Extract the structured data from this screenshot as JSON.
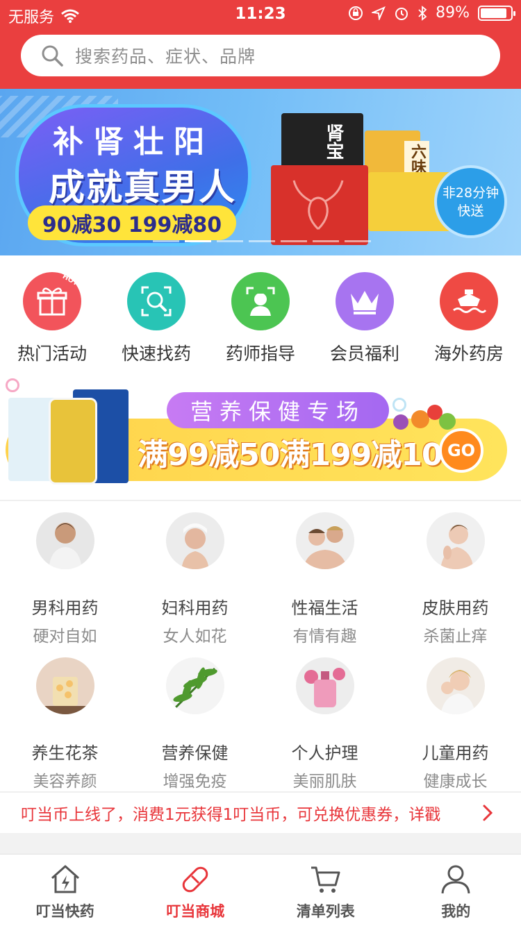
{
  "status_bar": {
    "carrier": "无服务",
    "time": "11:23",
    "battery_percent": "89%",
    "battery_level": 0.89
  },
  "search": {
    "placeholder": "搜索药品、症状、品牌",
    "icon": "search-icon"
  },
  "hero_banner": {
    "line1": "补肾壮阳",
    "line2": "成就真男人",
    "promo": "90减30  199减80",
    "box_label_1": "肾宝",
    "box_label_2": "六味",
    "badge_line1": "非28分钟",
    "badge_line2": "快送",
    "slide_count": 7,
    "active_slide": 1
  },
  "quick_menu": [
    {
      "label": "热门活动",
      "icon": "gift-icon",
      "color": "#f2545b",
      "hot": "HOT"
    },
    {
      "label": "快速找药",
      "icon": "scan-search-icon",
      "color": "#28c4b5"
    },
    {
      "label": "药师指导",
      "icon": "pharmacist-icon",
      "color": "#4cc552"
    },
    {
      "label": "会员福利",
      "icon": "crown-icon",
      "color": "#a774f0"
    },
    {
      "label": "海外药房",
      "icon": "ship-icon",
      "color": "#ef4a44"
    }
  ],
  "promo_banner": {
    "tag": "营养保健专场",
    "offer": "满99减50满199减100",
    "go": "GO"
  },
  "categories": [
    {
      "title": "男科用药",
      "subtitle": "硬对自如",
      "icon": "man-photo"
    },
    {
      "title": "妇科用药",
      "subtitle": "女人如花",
      "icon": "woman-photo"
    },
    {
      "title": "性福生活",
      "subtitle": "有情有趣",
      "icon": "couple-photo"
    },
    {
      "title": "皮肤用药",
      "subtitle": "杀菌止痒",
      "icon": "skin-photo"
    },
    {
      "title": "养生花茶",
      "subtitle": "美容养颜",
      "icon": "tea-photo"
    },
    {
      "title": "营养保健",
      "subtitle": "增强免疫",
      "icon": "leaf-photo"
    },
    {
      "title": "个人护理",
      "subtitle": "美丽肌肤",
      "icon": "perfume-photo"
    },
    {
      "title": "儿童用药",
      "subtitle": "健康成长",
      "icon": "child-photo"
    }
  ],
  "notice": {
    "text": "叮当币上线了，消费1元获得1叮当币，可兑换优惠券，详戳"
  },
  "tabbar": [
    {
      "label": "叮当快药",
      "icon": "home-bolt-icon",
      "active": false
    },
    {
      "label": "叮当商城",
      "icon": "pill-icon",
      "active": true
    },
    {
      "label": "清单列表",
      "icon": "cart-icon",
      "active": false
    },
    {
      "label": "我的",
      "icon": "user-icon",
      "active": false
    }
  ],
  "colors": {
    "brand_red": "#ea3f3f",
    "notice_red": "#e8353a"
  }
}
